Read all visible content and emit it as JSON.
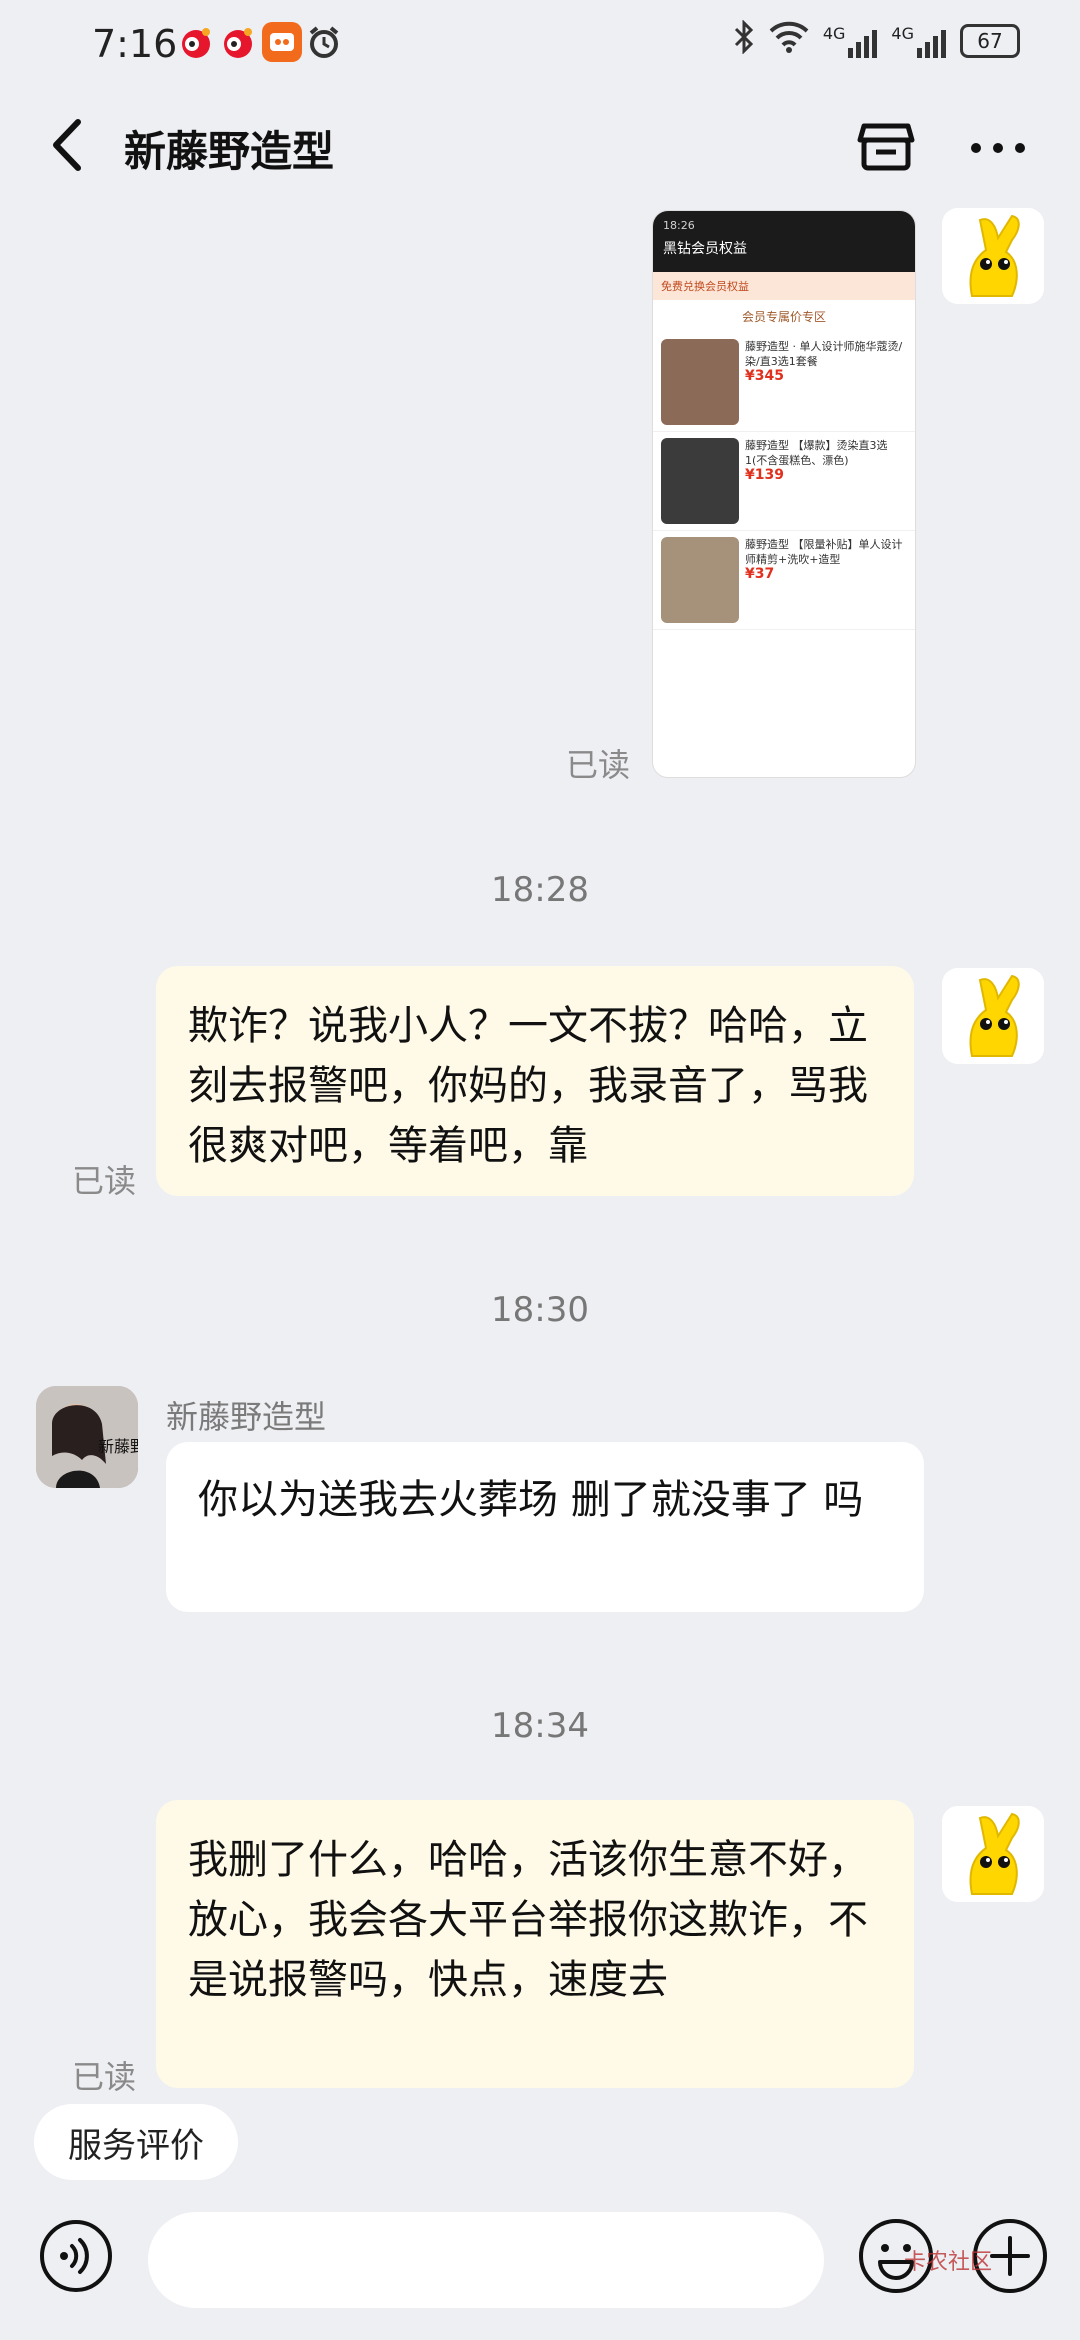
{
  "status_bar": {
    "time": "7:16",
    "battery": "67",
    "network": "4G"
  },
  "header": {
    "title": "新藤野造型"
  },
  "image_message": {
    "read_status": "已读",
    "preview_title": "黑钻会员权益",
    "preview_band": "免费兑换会员权益",
    "preview_section": "会员专属价专区",
    "items": [
      {
        "name": "藤野造型 · 单人设计师施华蔻烫/染/直3选1套餐",
        "price": "¥345"
      },
      {
        "name": "藤野造型 【爆款】烫染直3选1(不含蛋糕色、漂色)",
        "price": "¥139"
      },
      {
        "name": "藤野造型 【限量补贴】单人设计师精剪+洗吹+造型",
        "price": "¥37"
      }
    ]
  },
  "messages": [
    {
      "timestamp": "18:28",
      "text": "欺诈？说我小人？一文不拔？哈哈，立刻去报警吧，你妈的，我录音了，骂我很爽对吧，等着吧，靠",
      "read_status": "已读"
    },
    {
      "timestamp": "18:30",
      "sender": "新藤野造型",
      "text": "你以为送我去火葬场 删了就没事了 吗"
    },
    {
      "timestamp": "18:34",
      "text": "我删了什么，哈哈，活该你生意不好，放心，我会各大平台举报你这欺诈，不是说报警吗，快点，速度去",
      "read_status": "已读"
    }
  ],
  "footer": {
    "service_eval": "服务评价",
    "input_placeholder": "",
    "watermark": "卡农社区"
  },
  "colors": {
    "background": "#eeeff3",
    "my_bubble": "#fffae8",
    "other_bubble": "#ffffff",
    "avatar_yellow": "#ffd600"
  }
}
